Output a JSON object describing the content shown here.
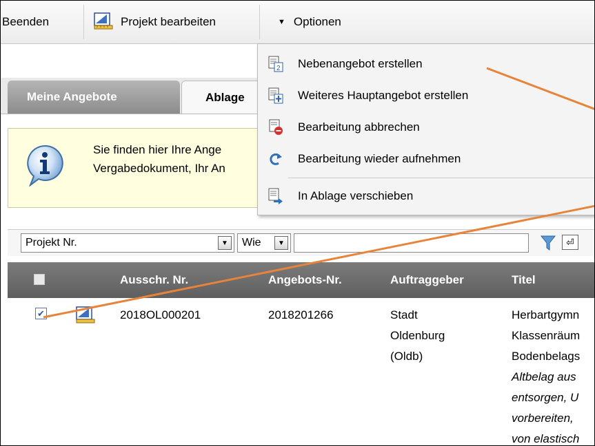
{
  "toolbar": {
    "beenden": "Beenden",
    "projekt_bearbeiten": "Projekt bearbeiten",
    "optionen": "Optionen"
  },
  "tabs": {
    "active": "Meine Angebote",
    "inactive": "Ablage"
  },
  "info": {
    "line1": "Sie finden hier Ihre Ange",
    "line2": "Vergabedokument, Ihr An"
  },
  "filter": {
    "field": "Projekt Nr.",
    "operator": "Wie",
    "value": ""
  },
  "table": {
    "columns": [
      "Ausschr. Nr.",
      "Angebots-Nr.",
      "Auftraggeber",
      "Titel"
    ],
    "row": {
      "checked": true,
      "ausschr_nr": "2018OL000201",
      "angebots_nr": "2018201266",
      "auftraggeber_lines": [
        "Stadt",
        "Oldenburg",
        "(Oldb)"
      ],
      "titel_lines": [
        "Herbartgymn",
        "Klassenräum",
        "Bodenbelags"
      ],
      "titel_italic_lines": [
        "Altbelag aus",
        "entsorgen, U",
        "vorbereiten,",
        "von elastisch"
      ]
    }
  },
  "menu": {
    "items": [
      {
        "label": "Nebenangebot erstellen",
        "icon": "nebenangebot-icon"
      },
      {
        "label": "Weiteres Hauptangebot erstellen",
        "icon": "hauptangebot-icon"
      },
      {
        "label": "Bearbeitung abbrechen",
        "icon": "abbrechen-icon"
      },
      {
        "label": "Bearbeitung wieder aufnehmen",
        "icon": "resume-icon"
      },
      {
        "label": "In Ablage verschieben",
        "icon": "ablage-icon"
      }
    ]
  },
  "colors": {
    "annotation": "#e8843a",
    "info_bg": "#ffffdf",
    "header_bg": "#6b6b6b"
  }
}
